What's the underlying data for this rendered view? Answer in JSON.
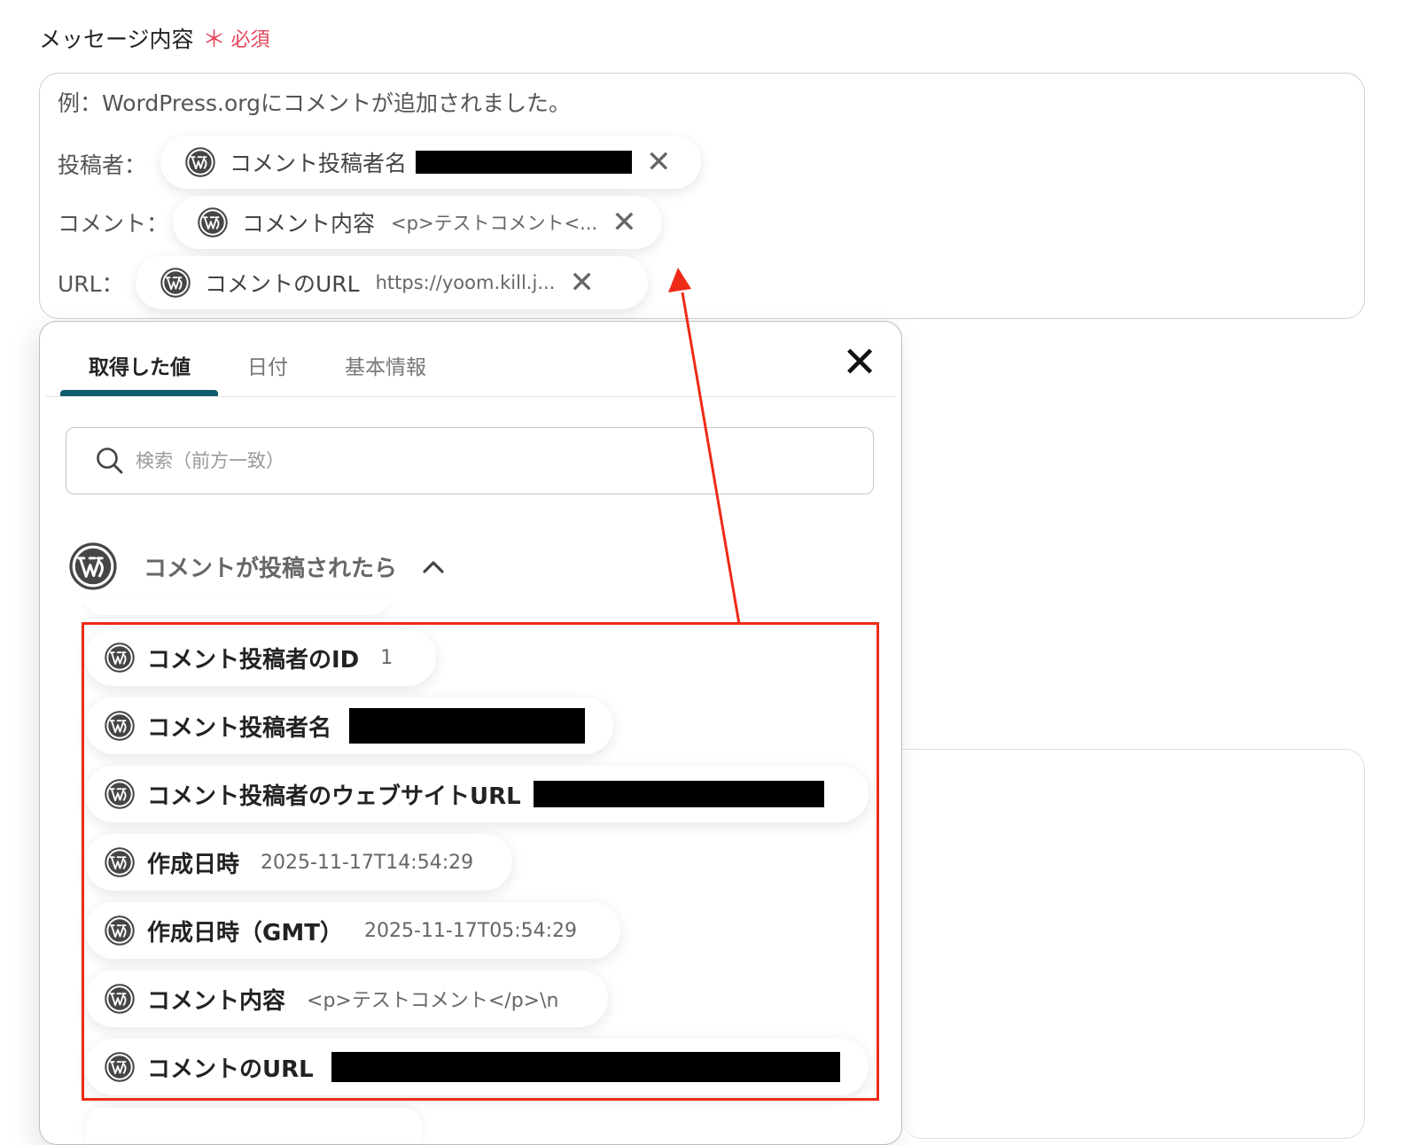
{
  "field": {
    "label": "メッセージ内容",
    "required_star": "＊",
    "required_text": "必須"
  },
  "message": {
    "line1": "例：WordPress.orgにコメントが追加されました。",
    "author_label": "投稿者：",
    "comment_label": "コメント：",
    "url_label": "URL：",
    "author_pill": {
      "name": "コメント投稿者名",
      "close": "✕"
    },
    "comment_pill": {
      "name": "コメント内容",
      "value": "<p>テストコメント<...",
      "close": "✕"
    },
    "url_pill": {
      "name": "コメントのURL",
      "value": "https://yoom.kill.j...",
      "close": "✕"
    }
  },
  "popup": {
    "tabs": [
      "取得した値",
      "日付",
      "基本情報"
    ],
    "close": "✕",
    "search_placeholder": "検索（前方一致）",
    "group_title": "コメントが投稿されたら",
    "items": [
      {
        "name": "コメント投稿者のID",
        "value": "1"
      },
      {
        "name": "コメント投稿者名",
        "value": ""
      },
      {
        "name": "コメント投稿者のウェブサイトURL",
        "value": ""
      },
      {
        "name": "作成日時",
        "value": "2025-11-17T14:54:29"
      },
      {
        "name": "作成日時（GMT）",
        "value": "2025-11-17T05:54:29"
      },
      {
        "name": "コメント内容",
        "value": "<p>テストコメント</p>\\n"
      },
      {
        "name": "コメントのURL",
        "value": ""
      }
    ]
  },
  "colors": {
    "required": "#e8455b",
    "tab_underline": "#0e5c6e",
    "annotation_red": "#ef2a16"
  },
  "icons": {
    "wordpress": "wordpress-icon",
    "search": "search-icon",
    "chevron": "chevron-up-icon",
    "close": "close-icon"
  }
}
